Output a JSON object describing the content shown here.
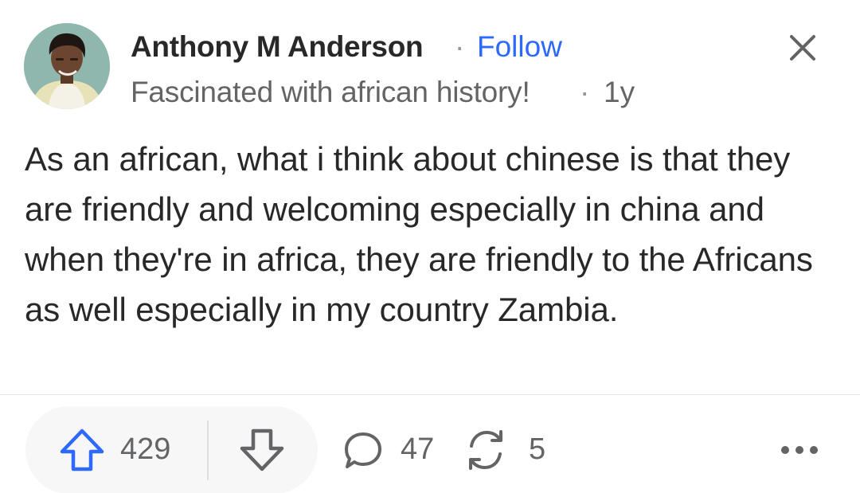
{
  "author": {
    "name": "Anthony M Anderson",
    "separator": "·",
    "follow_label": "Follow",
    "credential": "Fascinated with african history!",
    "age_separator": "·",
    "age": "1y",
    "avatar_icon": "user-avatar"
  },
  "answer": {
    "text": "As an african, what i think about chinese is that they are friendly and welcoming especially in china and when they're in africa, they are friendly to the Africans as well especially in my country Zambia."
  },
  "actions": {
    "upvote_count": "429",
    "comment_count": "47",
    "share_count": "5",
    "upvote_icon": "upvote-arrow-icon",
    "downvote_icon": "downvote-arrow-icon",
    "comment_icon": "comment-bubble-icon",
    "share_icon": "share-cycle-icon",
    "more_icon": "more-dots-icon",
    "close_icon": "close-icon"
  },
  "colors": {
    "accent": "#2e69ff",
    "text_primary": "#282829",
    "text_secondary": "#636466",
    "pill_bg": "#f7f7f8"
  }
}
